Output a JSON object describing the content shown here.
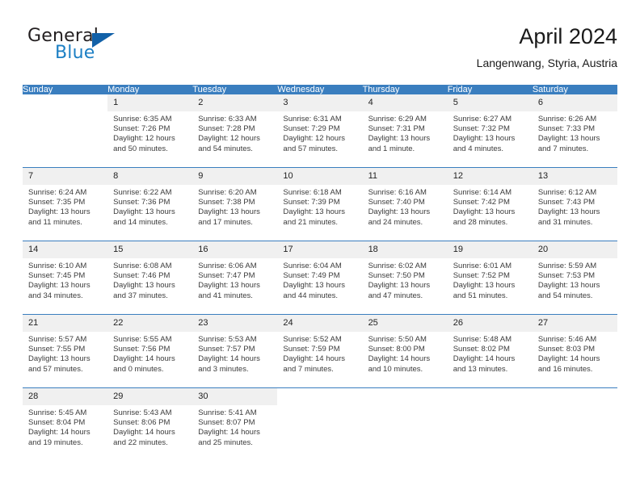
{
  "brand": {
    "name_part1": "General",
    "name_part2": "Blue",
    "logo_icon": "triangle-logo-icon",
    "accent_color": "#1261a8"
  },
  "header": {
    "title": "April 2024",
    "subtitle": "Langenwang, Styria, Austria"
  },
  "theme": {
    "header_row_bg": "#3a7ebf",
    "daynum_bg": "#f0f0f0",
    "row_divider": "#3a7ebf"
  },
  "weekday_headers": [
    "Sunday",
    "Monday",
    "Tuesday",
    "Wednesday",
    "Thursday",
    "Friday",
    "Saturday"
  ],
  "weeks": [
    [
      {
        "day": "",
        "sunrise": "",
        "sunset": "",
        "daylight_line1": "",
        "daylight_line2": ""
      },
      {
        "day": "1",
        "sunrise": "Sunrise: 6:35 AM",
        "sunset": "Sunset: 7:26 PM",
        "daylight_line1": "Daylight: 12 hours",
        "daylight_line2": "and 50 minutes."
      },
      {
        "day": "2",
        "sunrise": "Sunrise: 6:33 AM",
        "sunset": "Sunset: 7:28 PM",
        "daylight_line1": "Daylight: 12 hours",
        "daylight_line2": "and 54 minutes."
      },
      {
        "day": "3",
        "sunrise": "Sunrise: 6:31 AM",
        "sunset": "Sunset: 7:29 PM",
        "daylight_line1": "Daylight: 12 hours",
        "daylight_line2": "and 57 minutes."
      },
      {
        "day": "4",
        "sunrise": "Sunrise: 6:29 AM",
        "sunset": "Sunset: 7:31 PM",
        "daylight_line1": "Daylight: 13 hours",
        "daylight_line2": "and 1 minute."
      },
      {
        "day": "5",
        "sunrise": "Sunrise: 6:27 AM",
        "sunset": "Sunset: 7:32 PM",
        "daylight_line1": "Daylight: 13 hours",
        "daylight_line2": "and 4 minutes."
      },
      {
        "day": "6",
        "sunrise": "Sunrise: 6:26 AM",
        "sunset": "Sunset: 7:33 PM",
        "daylight_line1": "Daylight: 13 hours",
        "daylight_line2": "and 7 minutes."
      }
    ],
    [
      {
        "day": "7",
        "sunrise": "Sunrise: 6:24 AM",
        "sunset": "Sunset: 7:35 PM",
        "daylight_line1": "Daylight: 13 hours",
        "daylight_line2": "and 11 minutes."
      },
      {
        "day": "8",
        "sunrise": "Sunrise: 6:22 AM",
        "sunset": "Sunset: 7:36 PM",
        "daylight_line1": "Daylight: 13 hours",
        "daylight_line2": "and 14 minutes."
      },
      {
        "day": "9",
        "sunrise": "Sunrise: 6:20 AM",
        "sunset": "Sunset: 7:38 PM",
        "daylight_line1": "Daylight: 13 hours",
        "daylight_line2": "and 17 minutes."
      },
      {
        "day": "10",
        "sunrise": "Sunrise: 6:18 AM",
        "sunset": "Sunset: 7:39 PM",
        "daylight_line1": "Daylight: 13 hours",
        "daylight_line2": "and 21 minutes."
      },
      {
        "day": "11",
        "sunrise": "Sunrise: 6:16 AM",
        "sunset": "Sunset: 7:40 PM",
        "daylight_line1": "Daylight: 13 hours",
        "daylight_line2": "and 24 minutes."
      },
      {
        "day": "12",
        "sunrise": "Sunrise: 6:14 AM",
        "sunset": "Sunset: 7:42 PM",
        "daylight_line1": "Daylight: 13 hours",
        "daylight_line2": "and 28 minutes."
      },
      {
        "day": "13",
        "sunrise": "Sunrise: 6:12 AM",
        "sunset": "Sunset: 7:43 PM",
        "daylight_line1": "Daylight: 13 hours",
        "daylight_line2": "and 31 minutes."
      }
    ],
    [
      {
        "day": "14",
        "sunrise": "Sunrise: 6:10 AM",
        "sunset": "Sunset: 7:45 PM",
        "daylight_line1": "Daylight: 13 hours",
        "daylight_line2": "and 34 minutes."
      },
      {
        "day": "15",
        "sunrise": "Sunrise: 6:08 AM",
        "sunset": "Sunset: 7:46 PM",
        "daylight_line1": "Daylight: 13 hours",
        "daylight_line2": "and 37 minutes."
      },
      {
        "day": "16",
        "sunrise": "Sunrise: 6:06 AM",
        "sunset": "Sunset: 7:47 PM",
        "daylight_line1": "Daylight: 13 hours",
        "daylight_line2": "and 41 minutes."
      },
      {
        "day": "17",
        "sunrise": "Sunrise: 6:04 AM",
        "sunset": "Sunset: 7:49 PM",
        "daylight_line1": "Daylight: 13 hours",
        "daylight_line2": "and 44 minutes."
      },
      {
        "day": "18",
        "sunrise": "Sunrise: 6:02 AM",
        "sunset": "Sunset: 7:50 PM",
        "daylight_line1": "Daylight: 13 hours",
        "daylight_line2": "and 47 minutes."
      },
      {
        "day": "19",
        "sunrise": "Sunrise: 6:01 AM",
        "sunset": "Sunset: 7:52 PM",
        "daylight_line1": "Daylight: 13 hours",
        "daylight_line2": "and 51 minutes."
      },
      {
        "day": "20",
        "sunrise": "Sunrise: 5:59 AM",
        "sunset": "Sunset: 7:53 PM",
        "daylight_line1": "Daylight: 13 hours",
        "daylight_line2": "and 54 minutes."
      }
    ],
    [
      {
        "day": "21",
        "sunrise": "Sunrise: 5:57 AM",
        "sunset": "Sunset: 7:55 PM",
        "daylight_line1": "Daylight: 13 hours",
        "daylight_line2": "and 57 minutes."
      },
      {
        "day": "22",
        "sunrise": "Sunrise: 5:55 AM",
        "sunset": "Sunset: 7:56 PM",
        "daylight_line1": "Daylight: 14 hours",
        "daylight_line2": "and 0 minutes."
      },
      {
        "day": "23",
        "sunrise": "Sunrise: 5:53 AM",
        "sunset": "Sunset: 7:57 PM",
        "daylight_line1": "Daylight: 14 hours",
        "daylight_line2": "and 3 minutes."
      },
      {
        "day": "24",
        "sunrise": "Sunrise: 5:52 AM",
        "sunset": "Sunset: 7:59 PM",
        "daylight_line1": "Daylight: 14 hours",
        "daylight_line2": "and 7 minutes."
      },
      {
        "day": "25",
        "sunrise": "Sunrise: 5:50 AM",
        "sunset": "Sunset: 8:00 PM",
        "daylight_line1": "Daylight: 14 hours",
        "daylight_line2": "and 10 minutes."
      },
      {
        "day": "26",
        "sunrise": "Sunrise: 5:48 AM",
        "sunset": "Sunset: 8:02 PM",
        "daylight_line1": "Daylight: 14 hours",
        "daylight_line2": "and 13 minutes."
      },
      {
        "day": "27",
        "sunrise": "Sunrise: 5:46 AM",
        "sunset": "Sunset: 8:03 PM",
        "daylight_line1": "Daylight: 14 hours",
        "daylight_line2": "and 16 minutes."
      }
    ],
    [
      {
        "day": "28",
        "sunrise": "Sunrise: 5:45 AM",
        "sunset": "Sunset: 8:04 PM",
        "daylight_line1": "Daylight: 14 hours",
        "daylight_line2": "and 19 minutes."
      },
      {
        "day": "29",
        "sunrise": "Sunrise: 5:43 AM",
        "sunset": "Sunset: 8:06 PM",
        "daylight_line1": "Daylight: 14 hours",
        "daylight_line2": "and 22 minutes."
      },
      {
        "day": "30",
        "sunrise": "Sunrise: 5:41 AM",
        "sunset": "Sunset: 8:07 PM",
        "daylight_line1": "Daylight: 14 hours",
        "daylight_line2": "and 25 minutes."
      },
      {
        "day": "",
        "sunrise": "",
        "sunset": "",
        "daylight_line1": "",
        "daylight_line2": ""
      },
      {
        "day": "",
        "sunrise": "",
        "sunset": "",
        "daylight_line1": "",
        "daylight_line2": ""
      },
      {
        "day": "",
        "sunrise": "",
        "sunset": "",
        "daylight_line1": "",
        "daylight_line2": ""
      },
      {
        "day": "",
        "sunrise": "",
        "sunset": "",
        "daylight_line1": "",
        "daylight_line2": ""
      }
    ]
  ]
}
